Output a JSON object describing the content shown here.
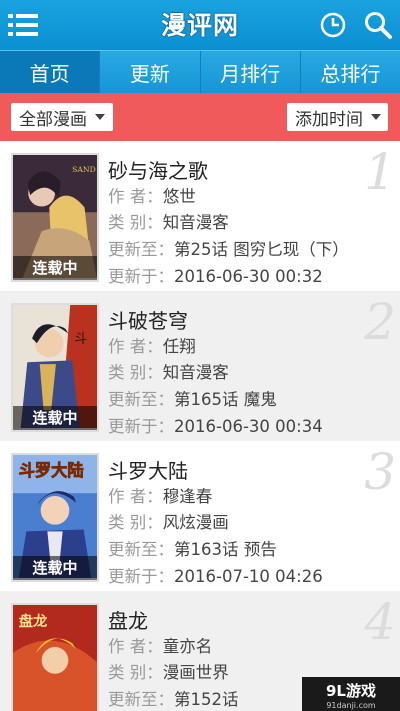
{
  "header": {
    "logo": "漫评网",
    "menu_icon": "menu-icon",
    "history_icon": "clock-icon",
    "search_icon": "search-icon"
  },
  "tabs": [
    {
      "label": "首页"
    },
    {
      "label": "更新"
    },
    {
      "label": "月排行"
    },
    {
      "label": "总排行"
    }
  ],
  "filters": {
    "category": "全部漫画",
    "sort": "添加时间"
  },
  "labels": {
    "author": "作 者：",
    "type": "类 别：",
    "updated_to": "更新至：",
    "updated_on": "更新于："
  },
  "comics": [
    {
      "index": "1",
      "title": "砂与海之歌",
      "author": "悠世",
      "type": "知音漫客",
      "latest": "第25话 图穷匕现（下）",
      "date": "2016-06-30 00:32",
      "status": "连载中"
    },
    {
      "index": "2",
      "title": "斗破苍穹",
      "author": "任翔",
      "type": "知音漫客",
      "latest": "第165话 魔鬼",
      "date": "2016-06-30 00:34",
      "status": "连载中"
    },
    {
      "index": "3",
      "title": "斗罗大陆",
      "author": "穆逢春",
      "type": "风炫漫画",
      "latest": "第163话 预告",
      "date": "2016-07-10 04:26",
      "status": "连载中"
    },
    {
      "index": "4",
      "title": "盘龙",
      "author": "童亦名",
      "type": "漫画世界",
      "latest": "第152话",
      "date": "",
      "status": ""
    }
  ],
  "watermark": {
    "name": "9L游戏",
    "url": "91danji.com"
  },
  "colors": {
    "header": "#0b8fd1",
    "tab_active": "#0b78b8",
    "filter_bar": "#f05a5a"
  }
}
